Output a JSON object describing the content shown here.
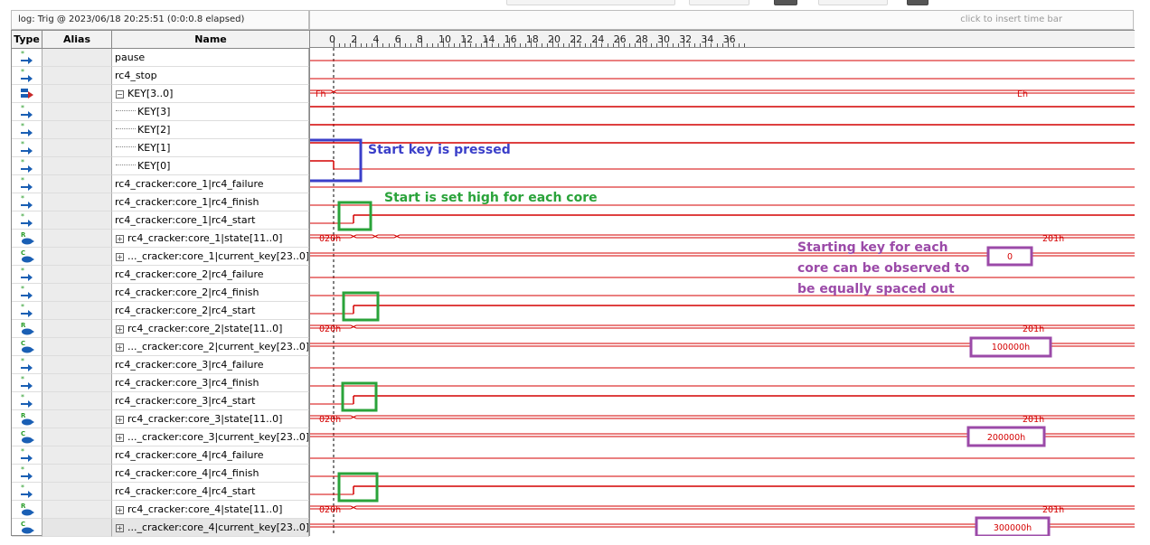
{
  "header": {
    "log_label": "log: Trig @ 2023/06/18 20:25:51 (0:0:0.8 elapsed)",
    "time_bar_hint": "click to insert time bar"
  },
  "columns": {
    "type": "Type",
    "alias": "Alias",
    "name": "Name"
  },
  "timeline": {
    "ticks": [
      "0",
      "2",
      "4",
      "6",
      "8",
      "10",
      "12",
      "14",
      "16",
      "18",
      "20",
      "22",
      "24",
      "26",
      "28",
      "30",
      "32",
      "34",
      "36"
    ],
    "first_label": "0"
  },
  "signals": [
    {
      "name": "pause",
      "type_icon": "input-pin-icon"
    },
    {
      "name": "rc4_stop",
      "type_icon": "input-pin-icon"
    },
    {
      "name": "KEY[3..0]",
      "type_icon": "bus-group-icon",
      "expanded": true,
      "values": [
        "Fh",
        "Eh"
      ]
    },
    {
      "name": "KEY[3]",
      "type_icon": "input-pin-icon"
    },
    {
      "name": "KEY[2]",
      "type_icon": "input-pin-icon"
    },
    {
      "name": "KEY[1]",
      "type_icon": "input-pin-icon"
    },
    {
      "name": "KEY[0]",
      "type_icon": "input-pin-icon"
    },
    {
      "name": "rc4_cracker:core_1|rc4_failure",
      "type_icon": "input-pin-icon"
    },
    {
      "name": "rc4_cracker:core_1|rc4_finish",
      "type_icon": "input-pin-icon"
    },
    {
      "name": "rc4_cracker:core_1|rc4_start",
      "type_icon": "input-pin-icon"
    },
    {
      "name": "rc4_cracker:core_1|state[11..0]",
      "type_icon": "register-bus-icon",
      "values": [
        "020h",
        "201h"
      ]
    },
    {
      "name": "..._cracker:core_1|current_key[23..0]",
      "type_icon": "combinational-bus-icon",
      "values": [
        "0"
      ]
    },
    {
      "name": "rc4_cracker:core_2|rc4_failure",
      "type_icon": "input-pin-icon"
    },
    {
      "name": "rc4_cracker:core_2|rc4_finish",
      "type_icon": "input-pin-icon"
    },
    {
      "name": "rc4_cracker:core_2|rc4_start",
      "type_icon": "input-pin-icon"
    },
    {
      "name": "rc4_cracker:core_2|state[11..0]",
      "type_icon": "register-bus-icon",
      "values": [
        "020h",
        "201h"
      ]
    },
    {
      "name": "..._cracker:core_2|current_key[23..0]",
      "type_icon": "combinational-bus-icon",
      "values": [
        "100000h"
      ]
    },
    {
      "name": "rc4_cracker:core_3|rc4_failure",
      "type_icon": "input-pin-icon"
    },
    {
      "name": "rc4_cracker:core_3|rc4_finish",
      "type_icon": "input-pin-icon"
    },
    {
      "name": "rc4_cracker:core_3|rc4_start",
      "type_icon": "input-pin-icon"
    },
    {
      "name": "rc4_cracker:core_3|state[11..0]",
      "type_icon": "register-bus-icon",
      "values": [
        "020h",
        "201h"
      ]
    },
    {
      "name": "..._cracker:core_3|current_key[23..0]",
      "type_icon": "combinational-bus-icon",
      "values": [
        "200000h"
      ]
    },
    {
      "name": "rc4_cracker:core_4|rc4_failure",
      "type_icon": "input-pin-icon"
    },
    {
      "name": "rc4_cracker:core_4|rc4_finish",
      "type_icon": "input-pin-icon"
    },
    {
      "name": "rc4_cracker:core_4|rc4_start",
      "type_icon": "input-pin-icon"
    },
    {
      "name": "rc4_cracker:core_4|state[11..0]",
      "type_icon": "register-bus-icon",
      "values": [
        "020h",
        "201h"
      ]
    },
    {
      "name": "..._cracker:core_4|current_key[23..0]",
      "type_icon": "combinational-bus-icon",
      "values": [
        "300000h"
      ]
    }
  ],
  "annotations": {
    "key_pressed": "Start key is pressed",
    "start_high": "Start is set high for each core",
    "starting_key_1": "Starting key for each",
    "starting_key_2": "core can be observed to",
    "starting_key_3": "be equally spaced out"
  },
  "colors": {
    "wave": "#d40000",
    "annotation_blue": "#3b3fc9",
    "annotation_green": "#2aa33a",
    "annotation_purple": "#9b4aa8"
  }
}
